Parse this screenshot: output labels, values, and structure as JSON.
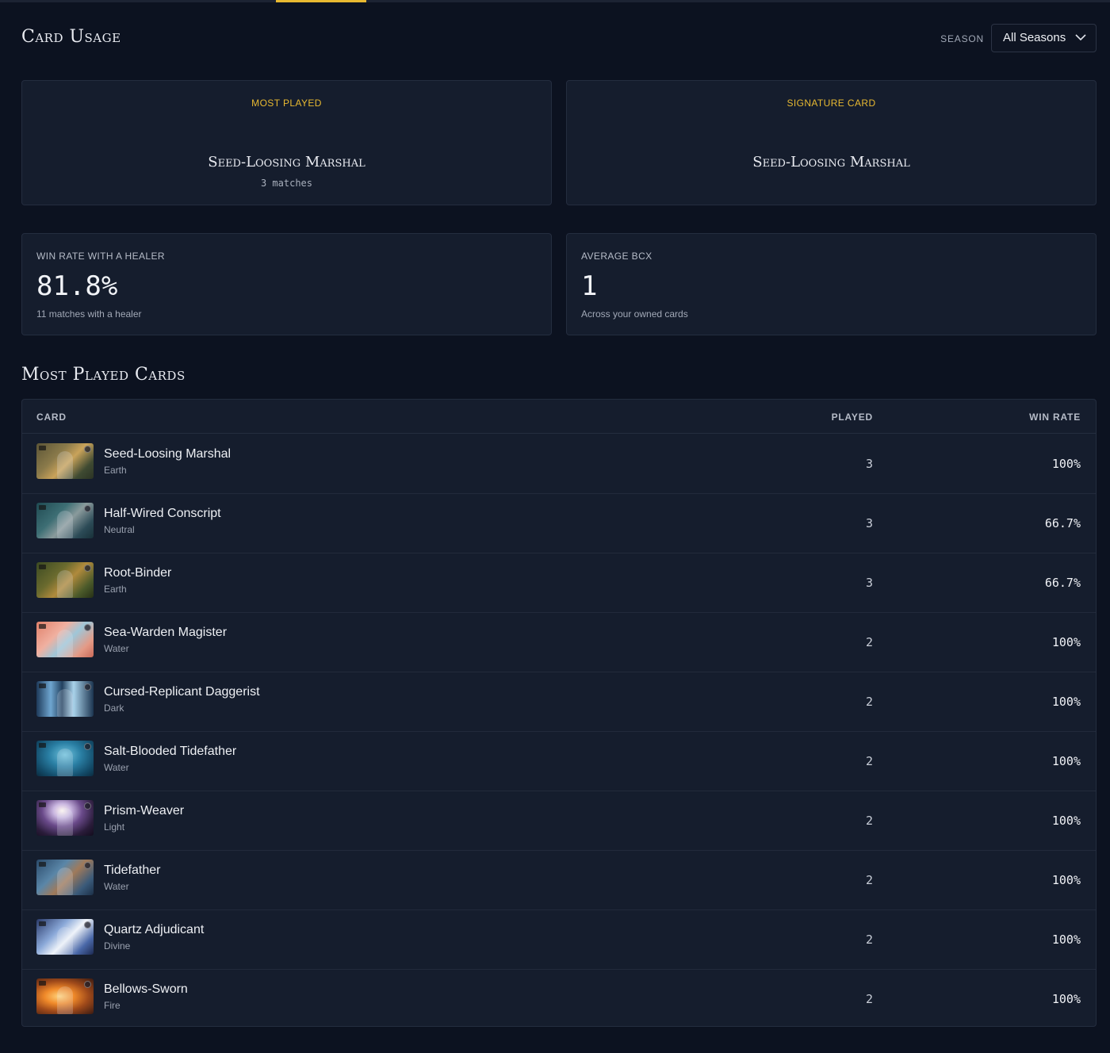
{
  "header": {
    "title": "Card Usage",
    "season_label": "SEASON",
    "season_value": "All Seasons"
  },
  "features": [
    {
      "label": "MOST PLAYED",
      "name": "Seed-Loosing Marshal",
      "sub": "3 matches"
    },
    {
      "label": "SIGNATURE CARD",
      "name": "Seed-Loosing Marshal",
      "sub": ""
    }
  ],
  "stats": [
    {
      "label": "WIN RATE WITH A HEALER",
      "value": "81.8%",
      "sub": "11 matches with a healer"
    },
    {
      "label": "AVERAGE BCX",
      "value": "1",
      "sub": "Across your owned cards"
    }
  ],
  "section_title": "Most Played Cards",
  "table": {
    "columns": [
      "CARD",
      "PLAYED",
      "WIN RATE"
    ],
    "rows": [
      {
        "name": "Seed-Loosing Marshal",
        "element": "Earth",
        "played": "3",
        "win_rate": "100%"
      },
      {
        "name": "Half-Wired Conscript",
        "element": "Neutral",
        "played": "3",
        "win_rate": "66.7%"
      },
      {
        "name": "Root-Binder",
        "element": "Earth",
        "played": "3",
        "win_rate": "66.7%"
      },
      {
        "name": "Sea-Warden Magister",
        "element": "Water",
        "played": "2",
        "win_rate": "100%"
      },
      {
        "name": "Cursed-Replicant Daggerist",
        "element": "Dark",
        "played": "2",
        "win_rate": "100%"
      },
      {
        "name": "Salt-Blooded Tidefather",
        "element": "Water",
        "played": "2",
        "win_rate": "100%"
      },
      {
        "name": "Prism-Weaver",
        "element": "Light",
        "played": "2",
        "win_rate": "100%"
      },
      {
        "name": "Tidefather",
        "element": "Water",
        "played": "2",
        "win_rate": "100%"
      },
      {
        "name": "Quartz Adjudicant",
        "element": "Divine",
        "played": "2",
        "win_rate": "100%"
      },
      {
        "name": "Bellows-Sworn",
        "element": "Fire",
        "played": "2",
        "win_rate": "100%"
      }
    ]
  },
  "colors": {
    "accent": "#e8b931",
    "background": "#0c1220",
    "panel": "#151d2d"
  }
}
